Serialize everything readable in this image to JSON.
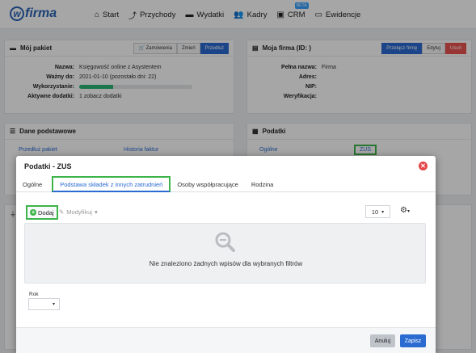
{
  "nav": {
    "logo": "wfirma",
    "items": [
      {
        "icon": "home-icon",
        "label": "Start"
      },
      {
        "icon": "chart-up-icon",
        "label": "Przychody"
      },
      {
        "icon": "wallet-icon",
        "label": "Wydatki"
      },
      {
        "icon": "users-icon",
        "label": "Kadry"
      },
      {
        "icon": "briefcase-icon",
        "label": "CRM",
        "badge": "BETA"
      },
      {
        "icon": "folder-icon",
        "label": "Ewidencje"
      }
    ]
  },
  "pakiet": {
    "title": "Mój pakiet",
    "btn_orders": "Zamówienia",
    "btn_change": "Zmień",
    "btn_extend": "Przedłuż",
    "rows": {
      "name_k": "Nazwa:",
      "name_v": "Księgowość online z Asystentem",
      "valid_k": "Ważny do:",
      "valid_v": "2021-01-10 (pozostało dni: 22)",
      "usage_k": "Wykorzystanie:",
      "addons_k": "Aktywne dodatki:",
      "addons_v": "1 zobacz dodatki"
    },
    "usage_fraction": 0.3
  },
  "firma": {
    "title": "Moja firma (ID:              )",
    "btn_switch": "Przełącz firmę",
    "btn_edit": "Edytuj",
    "btn_delete": "Usuń",
    "rows": {
      "fullname_k": "Pełna nazwa:",
      "fullname_v": "Firma",
      "address_k": "Adres:",
      "nip_k": "NIP:",
      "verif_k": "Weryfikacja:"
    }
  },
  "dane": {
    "title": "Dane podstawowe",
    "link1": "Przedłuż pakiet",
    "link2": "Historia faktur"
  },
  "podatki": {
    "title": "Podatki",
    "link1": "Ogólne",
    "link2": "ZUS"
  },
  "modal": {
    "title": "Podatki - ZUS",
    "tabs": [
      "Ogólne",
      "Podstawa składek z innych zatrudnień",
      "Osoby współpracujące",
      "Rodzina"
    ],
    "add": "Dodaj",
    "edit": "Modyfikuj",
    "page_size": "10",
    "empty": "Nie znaleziono żadnych wpisów dla wybranych filtrów",
    "year_label": "Rok",
    "cancel": "Anuluj",
    "save": "Zapisz"
  }
}
